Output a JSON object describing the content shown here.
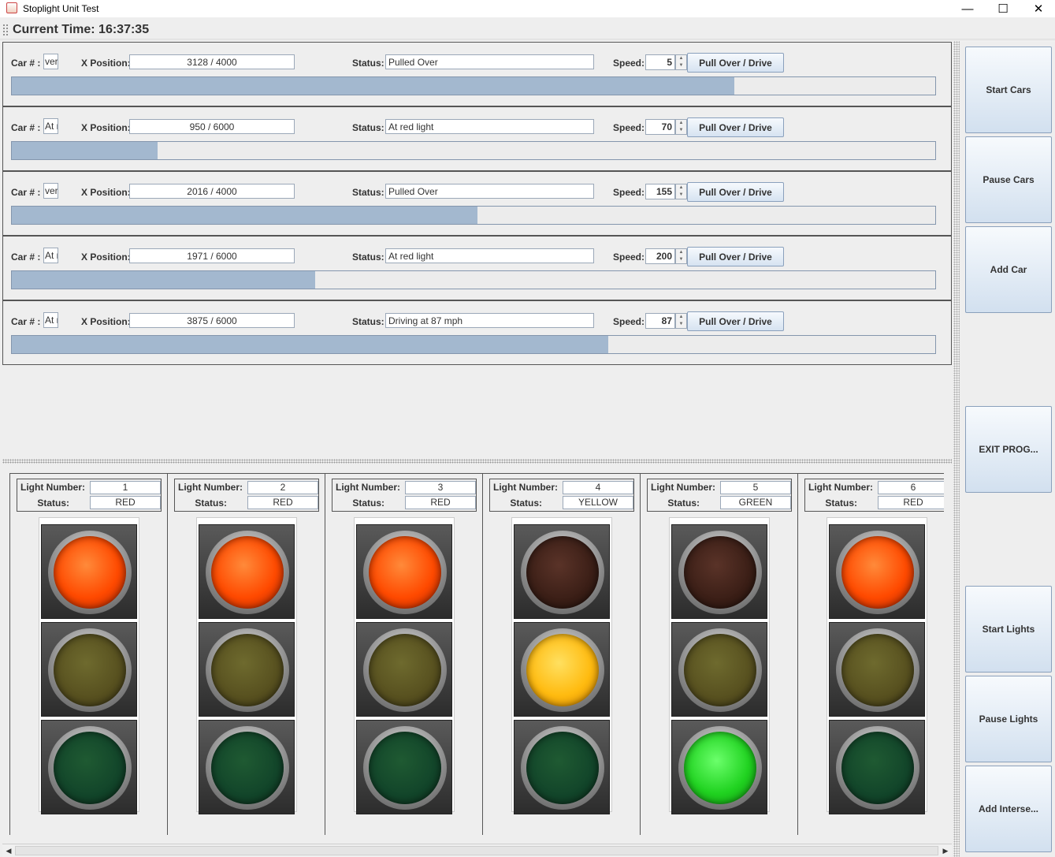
{
  "window": {
    "title": "Stoplight Unit Test"
  },
  "clock": {
    "label": "Current Time: 16:37:35"
  },
  "labels": {
    "car": "Car # :",
    "xpos": "X Position:",
    "status": "Status:",
    "speed": "Speed:",
    "pull": "Pull Over / Drive",
    "light_number": "Light Number:",
    "light_status": "Status:"
  },
  "cars": [
    {
      "car_field": "ver",
      "position": "3128 / 4000",
      "status": "Pulled Over",
      "speed": "5",
      "progress": 0.782
    },
    {
      "car_field": "At r",
      "position": "950 / 6000",
      "status": "At red light",
      "speed": "70",
      "progress": 0.158
    },
    {
      "car_field": "ver",
      "position": "2016 / 4000",
      "status": "Pulled Over",
      "speed": "155",
      "progress": 0.504
    },
    {
      "car_field": "At r",
      "position": "1971 / 6000",
      "status": "At red light",
      "speed": "200",
      "progress": 0.3285
    },
    {
      "car_field": "At r",
      "position": "3875 / 6000",
      "status": "Driving at 87 mph",
      "speed": "87",
      "progress": 0.6458
    }
  ],
  "lights": [
    {
      "number": "1",
      "status": "RED",
      "active": "red"
    },
    {
      "number": "2",
      "status": "RED",
      "active": "red"
    },
    {
      "number": "3",
      "status": "RED",
      "active": "red"
    },
    {
      "number": "4",
      "status": "YELLOW",
      "active": "yellow"
    },
    {
      "number": "5",
      "status": "GREEN",
      "active": "green"
    },
    {
      "number": "6",
      "status": "RED",
      "active": "red"
    }
  ],
  "controls": {
    "start_cars": "Start Cars",
    "pause_cars": "Pause Cars",
    "add_car": "Add Car",
    "exit": "EXIT PROG...",
    "start_lights": "Start Lights",
    "pause_lights": "Pause Lights",
    "add_intersection": "Add Interse..."
  }
}
